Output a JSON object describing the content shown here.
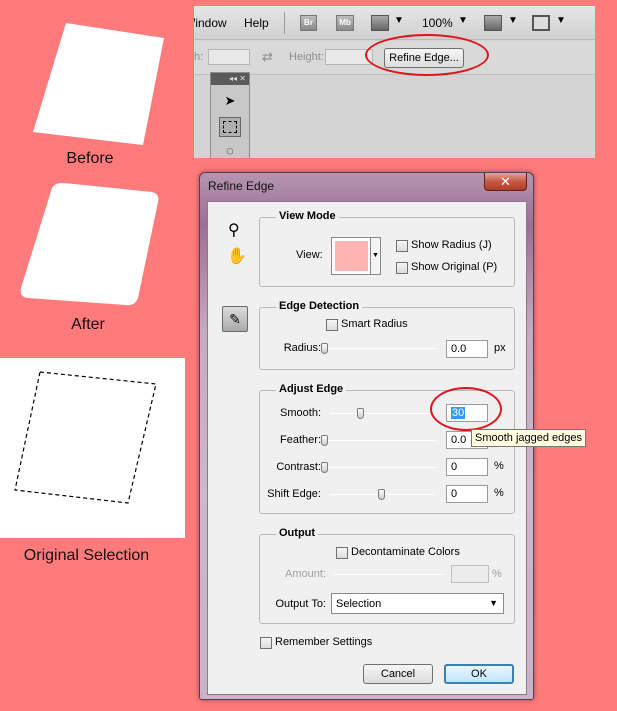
{
  "illustrations": {
    "before_label": "Before",
    "after_label": "After",
    "original_label": "Original Selection"
  },
  "menubar": {
    "menu_window": "Window",
    "menu_help": "Help",
    "bridge_icon": "Br",
    "minibridge_icon": "Mb",
    "zoom_value": "100%"
  },
  "options_bar": {
    "width_label": "Width:",
    "height_label": "Height:",
    "refine_edge_button": "Refine Edge..."
  },
  "tools_panel": {
    "collapse_icon": "◂◂",
    "close_icon": "✕"
  },
  "dialog": {
    "title": "Refine Edge",
    "close_glyph": "✕",
    "view_mode": {
      "title": "View Mode",
      "view_label": "View:",
      "show_radius": {
        "label": "Show Radius (J)",
        "checked": false
      },
      "show_original": {
        "label": "Show Original (P)",
        "checked": false
      },
      "preview_color": "#ffb3b3"
    },
    "edge_detection": {
      "title": "Edge Detection",
      "smart_radius": {
        "label": "Smart Radius",
        "checked": false
      },
      "radius_label": "Radius:",
      "radius_value": "0.0",
      "radius_unit": "px",
      "radius_level": 0
    },
    "adjust_edge": {
      "title": "Adjust Edge",
      "smooth_label": "Smooth:",
      "smooth_value": "30",
      "smooth_level": 0.3,
      "feather_label": "Feather:",
      "feather_value": "0.0",
      "feather_level": 0,
      "contrast_label": "Contrast:",
      "contrast_value": "0",
      "contrast_unit": "%",
      "contrast_level": 0,
      "shift_label": "Shift Edge:",
      "shift_value": "0",
      "shift_unit": "%",
      "shift_level": 0.5,
      "tooltip": "Smooth jagged edges"
    },
    "output": {
      "title": "Output",
      "decontaminate": {
        "label": "Decontaminate Colors",
        "checked": false
      },
      "amount_label": "Amount:",
      "amount_unit": "%",
      "output_to_label": "Output To:",
      "output_to_value": "Selection"
    },
    "remember": {
      "label": "Remember Settings",
      "checked": false
    },
    "cancel_button": "Cancel",
    "ok_button": "OK"
  },
  "colors": {
    "background": "#ff7b7b",
    "highlight_ring": "#e0141e"
  }
}
